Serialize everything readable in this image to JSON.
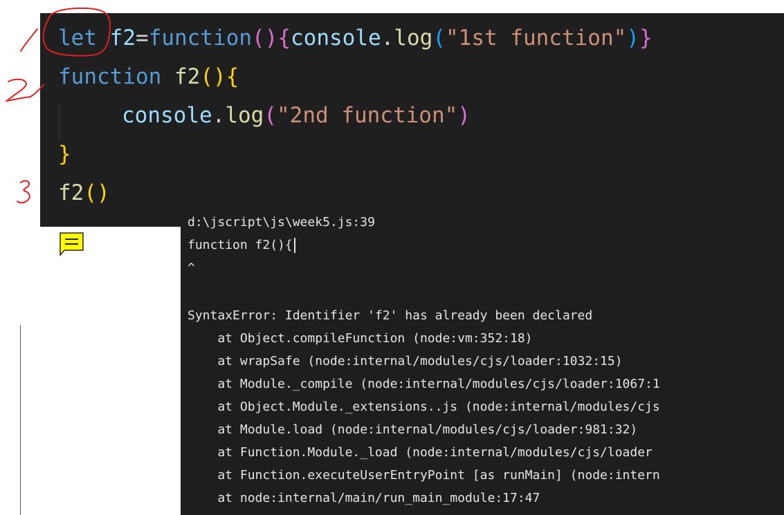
{
  "editor": {
    "line1": {
      "kw": "let",
      "name": "f2",
      "eq": "=",
      "fn_kw": "function",
      "paren_open": "(",
      "paren_close": ")",
      "brace_open": "{",
      "obj": "console",
      "dot": ".",
      "method": "log",
      "call_open": "(",
      "str": "\"1st function\"",
      "call_close": ")",
      "brace_close": "}"
    },
    "line2": {
      "fn_kw": "function",
      "name": "f2",
      "parens": "()",
      "brace_open": "{"
    },
    "line3": {
      "obj": "console",
      "dot": ".",
      "method": "log",
      "call_open": "(",
      "str": "\"2nd function\"",
      "call_close": ")"
    },
    "line4": {
      "brace_close": "}"
    },
    "line5": {
      "name": "f2",
      "parens": "()"
    }
  },
  "terminal": {
    "lines": [
      "d:\\jscript\\js\\week5.js:39",
      "function f2(){",
      "^",
      "",
      "SyntaxError: Identifier 'f2' has already been declared",
      "    at Object.compileFunction (node:vm:352:18)",
      "    at wrapSafe (node:internal/modules/cjs/loader:1032:15)",
      "    at Module._compile (node:internal/modules/cjs/loader:1067:1",
      "    at Object.Module._extensions..js (node:internal/modules/cjs",
      "    at Module.load (node:internal/modules/cjs/loader:981:32)",
      "    at Function.Module._load (node:internal/modules/cjs/loader",
      "    at Function.executeUserEntryPoint [as runMain] (node:intern",
      "    at node:internal/main/run_main_module:17:47"
    ]
  },
  "icons": {
    "note": "note-icon"
  },
  "colors": {
    "editor_bg": "#1f1f1f",
    "terminal_bg": "#1e1e1e",
    "annotation_red": "#e02020",
    "note_yellow": "#ffff00"
  }
}
